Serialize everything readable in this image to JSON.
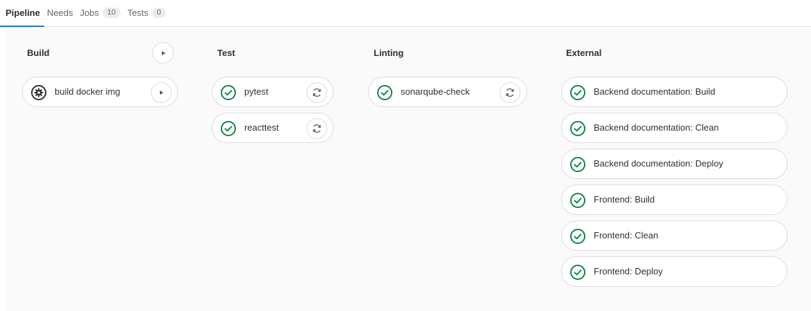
{
  "tabs": [
    {
      "label": "Pipeline",
      "active": true
    },
    {
      "label": "Needs"
    },
    {
      "label": "Jobs",
      "count": "10"
    },
    {
      "label": "Tests",
      "count": "0"
    }
  ],
  "stages": [
    {
      "name": "Build",
      "jobs": [
        {
          "name": "build docker img",
          "status": "manual",
          "action": "play-icon"
        }
      ]
    },
    {
      "name": "Test",
      "jobs": [
        {
          "name": "pytest",
          "status": "success",
          "action": "retry-icon"
        },
        {
          "name": "reacttest",
          "status": "success",
          "action": "retry-icon"
        }
      ]
    },
    {
      "name": "Linting",
      "jobs": [
        {
          "name": "sonarqube-check",
          "status": "success",
          "action": "retry-icon"
        }
      ]
    },
    {
      "name": "External",
      "jobs": [
        {
          "name": "Backend documentation: Build",
          "status": "success"
        },
        {
          "name": "Backend documentation: Clean",
          "status": "success"
        },
        {
          "name": "Backend documentation: Deploy",
          "status": "success"
        },
        {
          "name": "Frontend: Build",
          "status": "success"
        },
        {
          "name": "Frontend: Clean",
          "status": "success"
        },
        {
          "name": "Frontend: Deploy",
          "status": "success"
        }
      ]
    }
  ],
  "colors": {
    "success": "#108548",
    "manual": "#303030",
    "accent": "#1f75cb"
  }
}
